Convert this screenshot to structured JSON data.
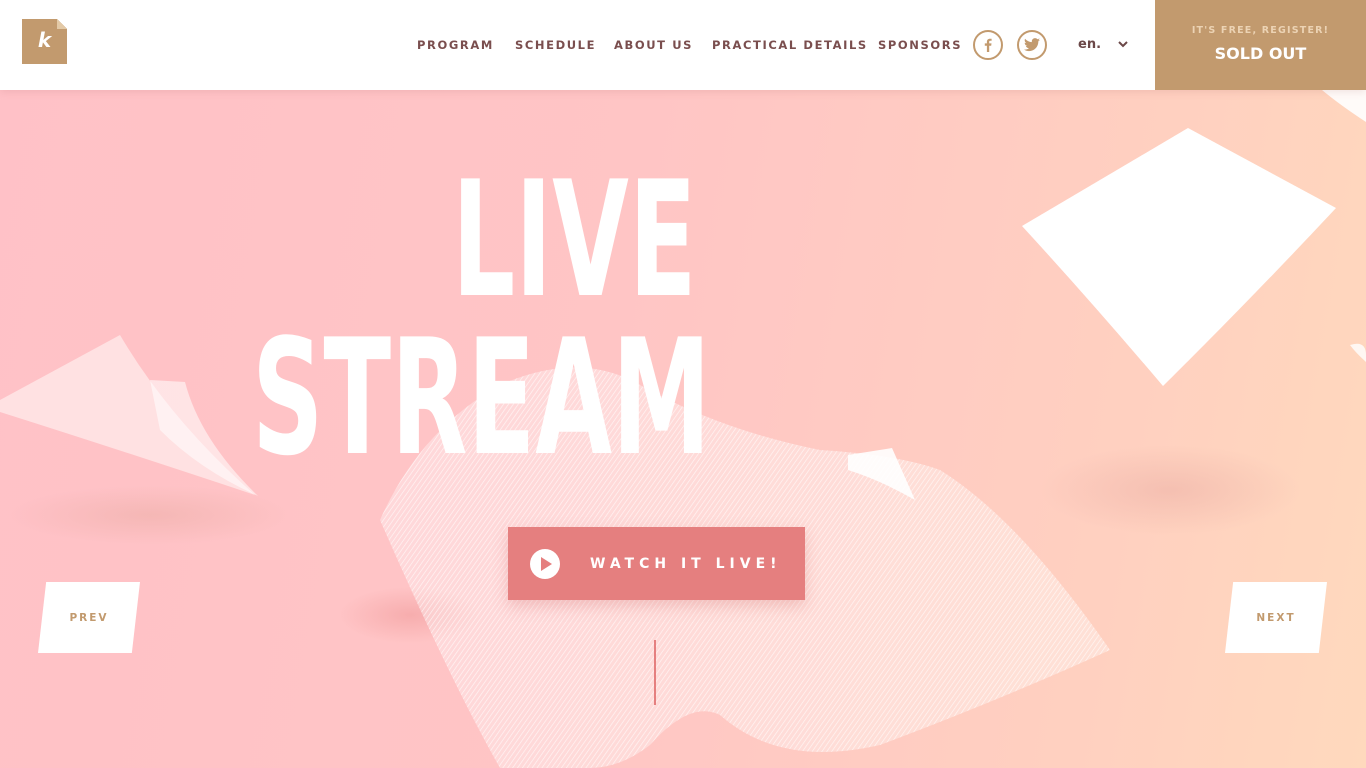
{
  "nav": {
    "items": [
      {
        "label": "PROGRAM"
      },
      {
        "label": "SCHEDULE"
      },
      {
        "label": "ABOUT US"
      },
      {
        "label": "PRACTICAL DETAILS"
      },
      {
        "label": "SPONSORS"
      }
    ]
  },
  "social": {
    "facebook_icon": "facebook-icon",
    "twitter_icon": "twitter-icon"
  },
  "language": {
    "current": "en."
  },
  "register": {
    "subtitle": "IT'S FREE, REGISTER!",
    "status": "SOLD OUT"
  },
  "hero": {
    "title_line1": "LIVE",
    "title_line2": "STREAM",
    "cta_label": "WATCH IT LIVE!"
  },
  "slider": {
    "prev_label": "PREV",
    "next_label": "NEXT"
  },
  "colors": {
    "accent": "#c29a6e",
    "cta": "#e57f7f",
    "nav_text": "#7a4e4e",
    "background": "#ffc5c5"
  }
}
